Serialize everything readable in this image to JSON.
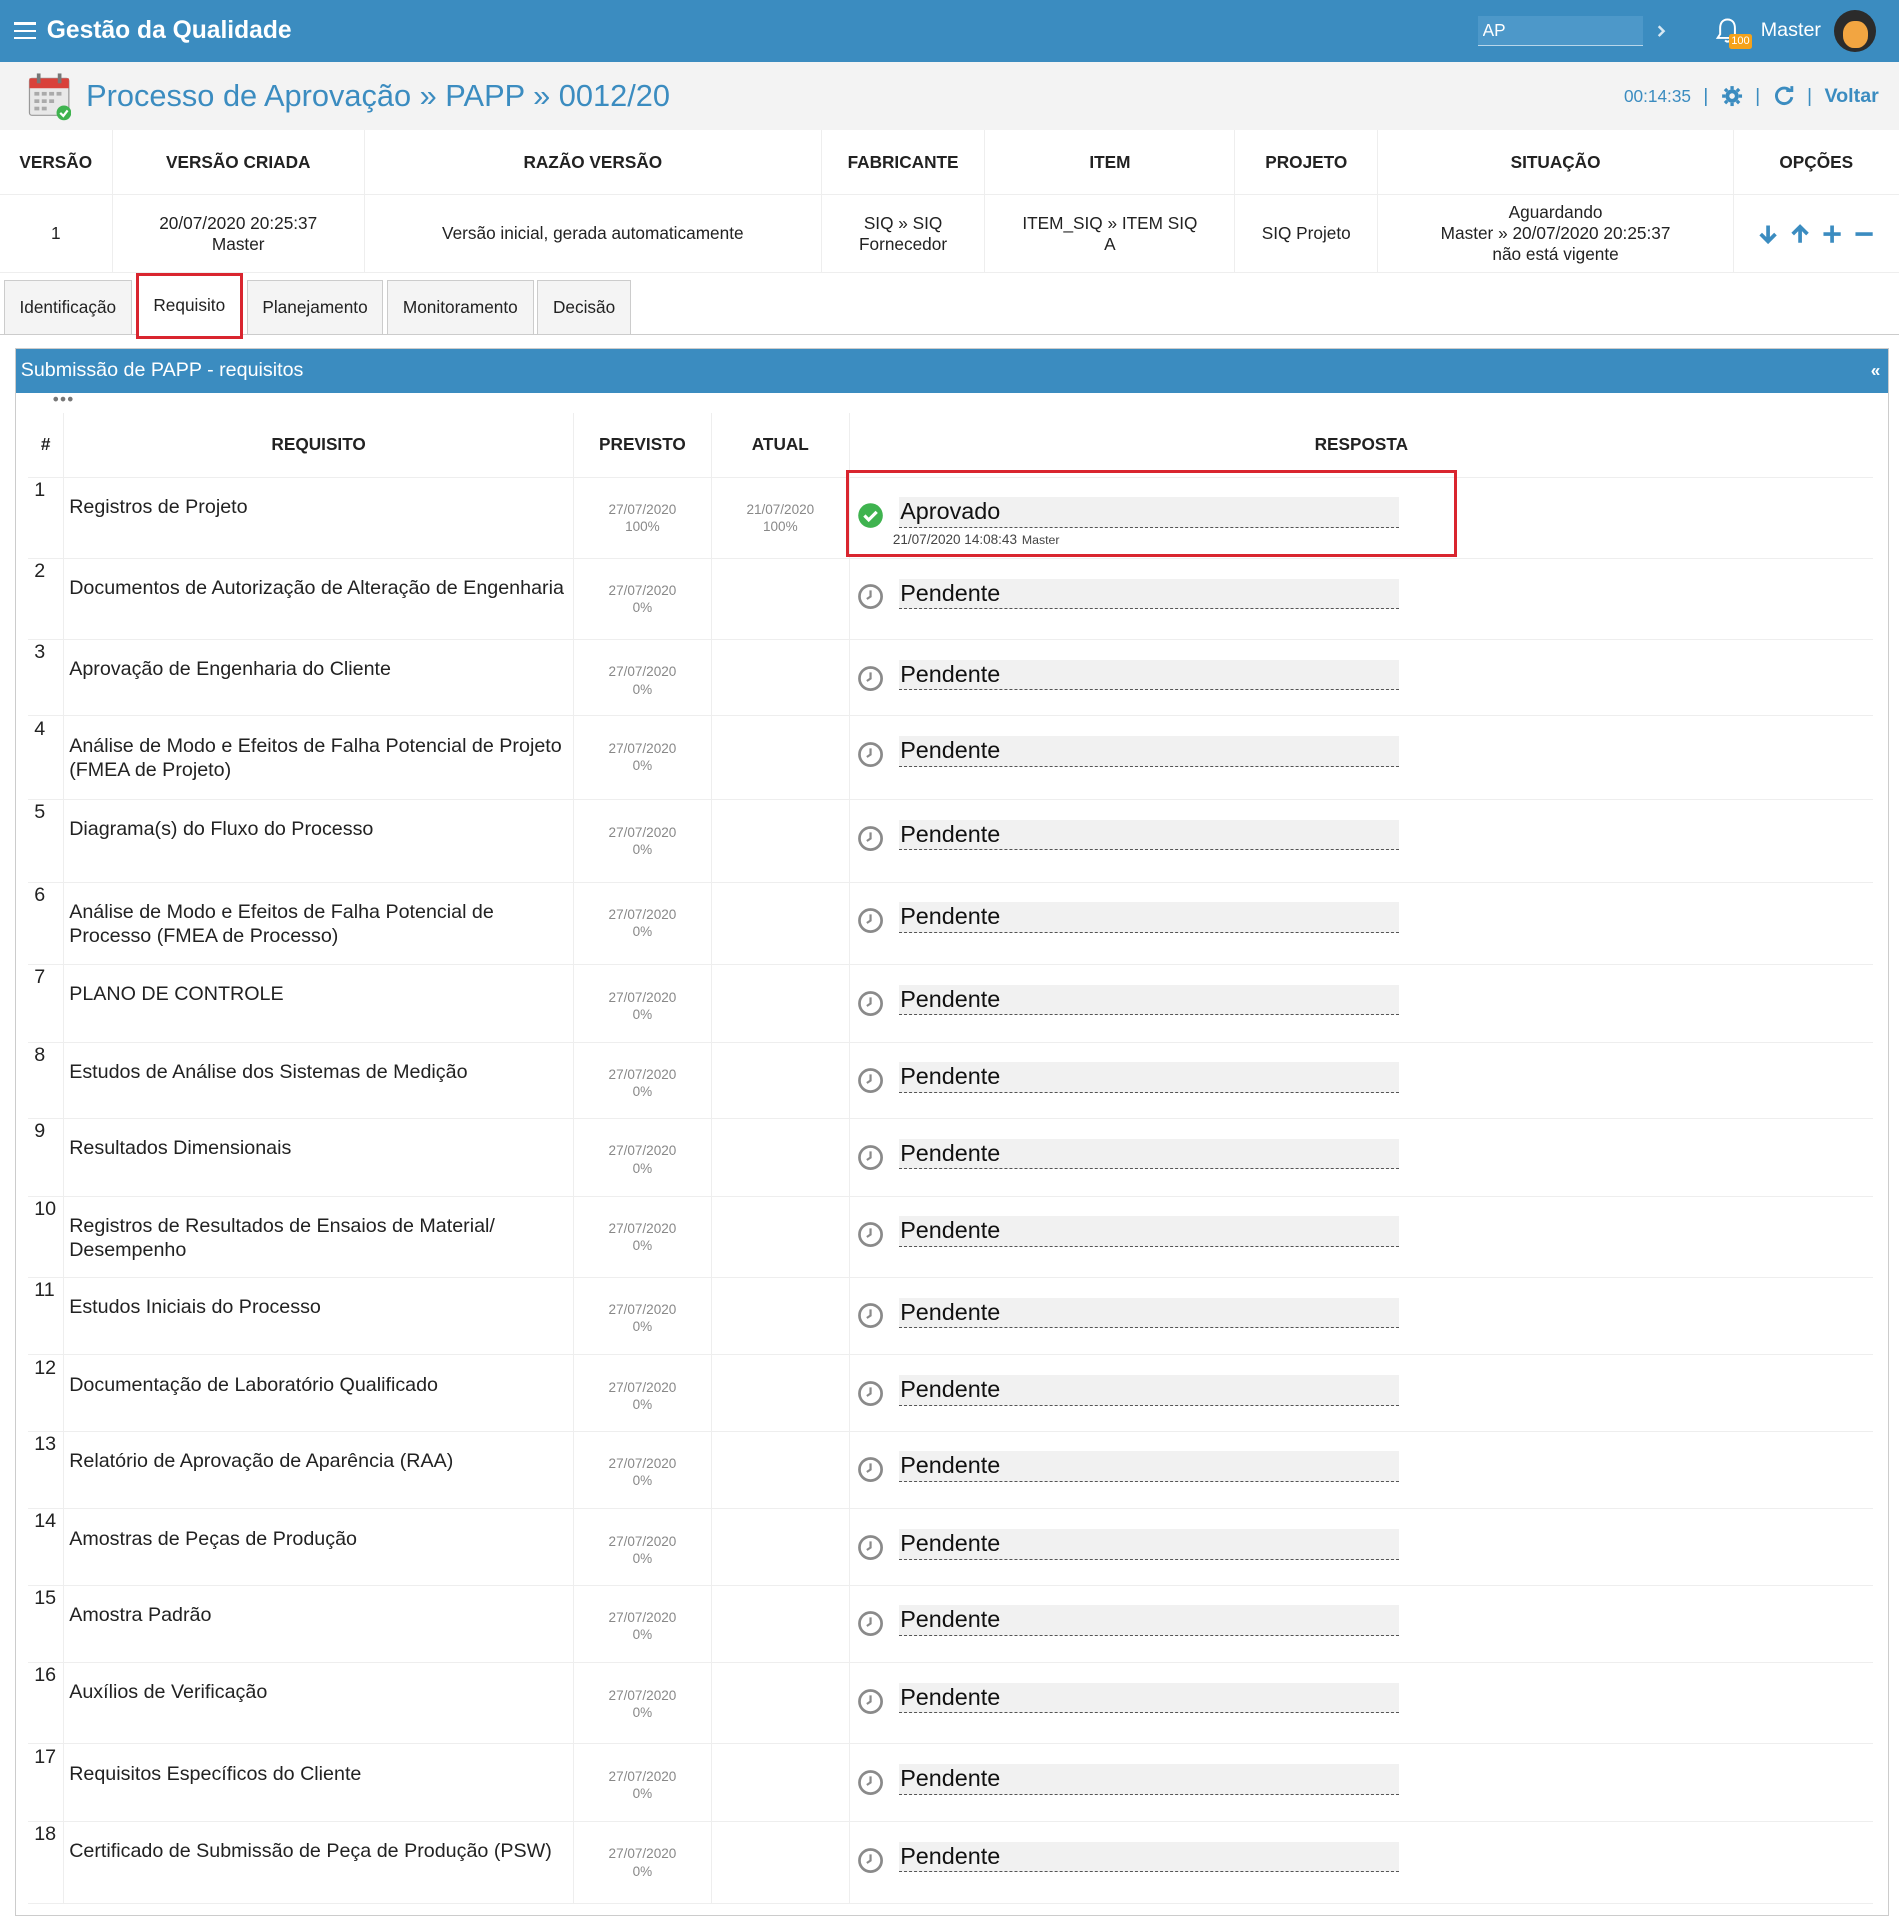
{
  "app": {
    "title": "Gestão da Qualidade",
    "search_value": "AP",
    "notification_count": "100",
    "user": "Master"
  },
  "header": {
    "title": "Processo de Aprovação » PAPP » 0012/20",
    "timer": "00:14:35",
    "back_label": "Voltar",
    "separator": "|"
  },
  "version_table": {
    "columns": [
      "VERSÃO",
      "VERSÃO CRIADA",
      "RAZÃO VERSÃO",
      "FABRICANTE",
      "ITEM",
      "PROJETO",
      "SITUAÇÃO",
      "OPÇÕES"
    ],
    "row": {
      "versao": "1",
      "criada_date": "20/07/2020 20:25:37",
      "criada_user": "Master",
      "razao": "Versão inicial, gerada automaticamente",
      "fabricante_1": "SIQ » SIQ",
      "fabricante_2": "Fornecedor",
      "item_1": "ITEM_SIQ » ITEM SIQ",
      "item_2": "A",
      "projeto": "SIQ Projeto",
      "situacao_1": "Aguardando",
      "situacao_2": "Master » 20/07/2020 20:25:37",
      "situacao_3": "não está vigente"
    },
    "options": [
      "arrow-down-icon",
      "arrow-up-icon",
      "plus-icon",
      "minus-icon"
    ]
  },
  "tabs": [
    {
      "label": "Identificação",
      "active": false
    },
    {
      "label": "Requisito",
      "active": true
    },
    {
      "label": "Planejamento",
      "active": false
    },
    {
      "label": "Monitoramento",
      "active": false
    },
    {
      "label": "Decisão",
      "active": false
    }
  ],
  "panel": {
    "title": "Submissão de PAPP - requisitos",
    "collapse_label": "«",
    "dots": "•••"
  },
  "requirements": {
    "columns": [
      "#",
      "REQUISITO",
      "PREVISTO",
      "ATUAL",
      "RESPOSTA"
    ],
    "rows": [
      {
        "num": "1",
        "name": "Registros de Projeto",
        "prev_date": "27/07/2020",
        "prev_pct": "100%",
        "atual_date": "21/07/2020",
        "atual_pct": "100%",
        "status": "Aprovado",
        "meta_date": "21/07/2020 14:08:43",
        "meta_user": "Master"
      },
      {
        "num": "2",
        "name": "Documentos de Autorização de Alteração de Engenharia",
        "prev_date": "27/07/2020",
        "prev_pct": "0%",
        "status": "Pendente"
      },
      {
        "num": "3",
        "name": "Aprovação de Engenharia do Cliente",
        "prev_date": "27/07/2020",
        "prev_pct": "0%",
        "status": "Pendente"
      },
      {
        "num": "4",
        "name": "Análise de Modo e Efeitos de Falha Potencial de Projeto (FMEA de Projeto)",
        "prev_date": "27/07/2020",
        "prev_pct": "0%",
        "status": "Pendente"
      },
      {
        "num": "5",
        "name": "Diagrama(s) do Fluxo do Processo",
        "prev_date": "27/07/2020",
        "prev_pct": "0%",
        "status": "Pendente"
      },
      {
        "num": "6",
        "name": "Análise de Modo e Efeitos de Falha Potencial de Processo (FMEA de Processo)",
        "prev_date": "27/07/2020",
        "prev_pct": "0%",
        "status": "Pendente"
      },
      {
        "num": "7",
        "name": "PLANO DE CONTROLE",
        "prev_date": "27/07/2020",
        "prev_pct": "0%",
        "status": "Pendente"
      },
      {
        "num": "8",
        "name": "Estudos de Análise dos Sistemas de Medição",
        "prev_date": "27/07/2020",
        "prev_pct": "0%",
        "status": "Pendente"
      },
      {
        "num": "9",
        "name": "Resultados Dimensionais",
        "prev_date": "27/07/2020",
        "prev_pct": "0%",
        "status": "Pendente"
      },
      {
        "num": "10",
        "name": "Registros de Resultados de Ensaios de Material/ Desempenho",
        "prev_date": "27/07/2020",
        "prev_pct": "0%",
        "status": "Pendente"
      },
      {
        "num": "11",
        "name": "Estudos Iniciais do Processo",
        "prev_date": "27/07/2020",
        "prev_pct": "0%",
        "status": "Pendente"
      },
      {
        "num": "12",
        "name": "Documentação de Laboratório Qualificado",
        "prev_date": "27/07/2020",
        "prev_pct": "0%",
        "status": "Pendente"
      },
      {
        "num": "13",
        "name": "Relatório de Aprovação de Aparência (RAA)",
        "prev_date": "27/07/2020",
        "prev_pct": "0%",
        "status": "Pendente"
      },
      {
        "num": "14",
        "name": "Amostras de Peças de Produção",
        "prev_date": "27/07/2020",
        "prev_pct": "0%",
        "status": "Pendente"
      },
      {
        "num": "15",
        "name": "Amostra Padrão",
        "prev_date": "27/07/2020",
        "prev_pct": "0%",
        "status": "Pendente"
      },
      {
        "num": "16",
        "name": "Auxílios de Verificação",
        "prev_date": "27/07/2020",
        "prev_pct": "0%",
        "status": "Pendente"
      },
      {
        "num": "17",
        "name": "Requisitos Específicos do Cliente",
        "prev_date": "27/07/2020",
        "prev_pct": "0%",
        "status": "Pendente"
      },
      {
        "num": "18",
        "name": "Certificado de Submissão de Peça de Produção (PSW)",
        "prev_date": "27/07/2020",
        "prev_pct": "0%",
        "status": "Pendente"
      }
    ]
  },
  "colors": {
    "primary": "#3b8cc0",
    "highlight": "#d9252f",
    "approved": "#3fb34f",
    "badge": "#f5a21b"
  }
}
